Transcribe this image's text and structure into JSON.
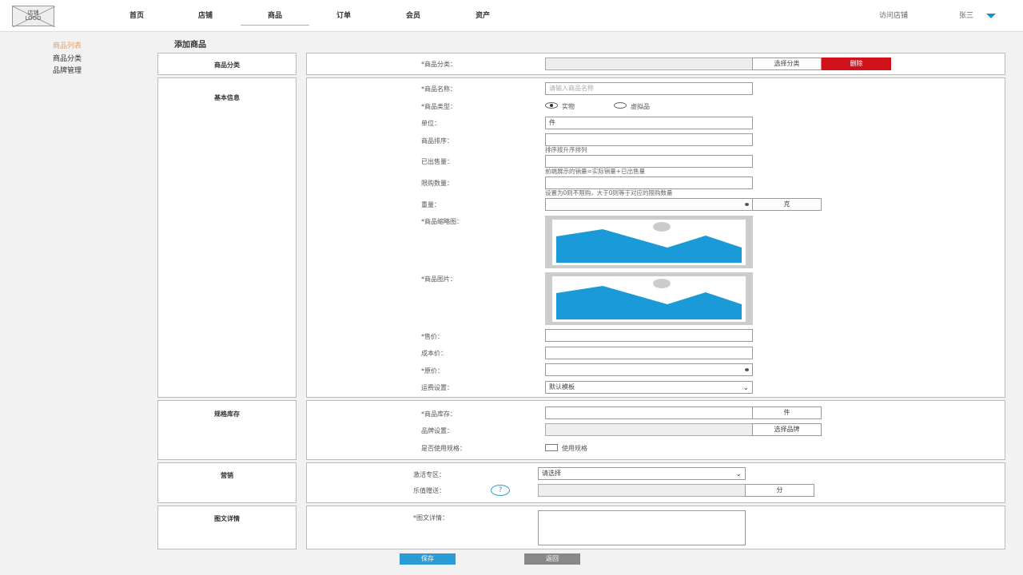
{
  "header": {
    "logo_line1": "店铺",
    "logo_line2": "LOGO",
    "nav": [
      "首页",
      "店铺",
      "商品",
      "订单",
      "会员",
      "资产"
    ],
    "visit_store": "访问店铺",
    "user": "张三"
  },
  "sidebar": {
    "items": [
      "商品列表",
      "商品分类",
      "品牌管理"
    ]
  },
  "page_title": "添加商品",
  "category_section": {
    "title": "商品分类",
    "category_label": "*商品分类：",
    "select_button": "选择分类",
    "delete_button": "删除"
  },
  "basic_section": {
    "title": "基本信息",
    "name_label": "*商品名称：",
    "name_placeholder": "请输入商品名称",
    "type_label": "*商品类型：",
    "type_options": [
      "实物",
      "虚拟品"
    ],
    "type_selected": "实物",
    "unit_label": "单位：",
    "unit_value": "件",
    "sort_label": "商品排序：",
    "sort_hint": "排序按升序排列",
    "sold_label": "已出售量：",
    "sold_hint": "前端展示的销量=实际销量+已出售量",
    "limit_label": "限购数量：",
    "limit_hint": "设置为0则不限购，大于0则等于对应的限购数量",
    "weight_label": "重量：",
    "weight_unit": "克",
    "thumb_label": "*商品缩略图：",
    "image_label": "*商品图片：",
    "price_label": "*售价：",
    "cost_label": "成本价：",
    "original_label": "*原价：",
    "shipping_label": "运费设置：",
    "shipping_value": "默认模板"
  },
  "spec_section": {
    "title": "规格库存",
    "stock_label": "*商品库存：",
    "stock_unit": "件",
    "brand_label": "品牌设置：",
    "brand_button": "选择品牌",
    "use_spec_label": "是否使用规格：",
    "use_spec_checkbox": "使用规格"
  },
  "marketing_section": {
    "title": "营销",
    "zone_label": "激活专区：",
    "zone_value": "请选择",
    "gift_label": "乐值赠送：",
    "gift_unit": "分",
    "help_glyph": "?"
  },
  "detail_section": {
    "title": "图文详情",
    "detail_label": "*图文详情："
  },
  "actions": {
    "save": "保存",
    "back": "返回"
  },
  "colors": {
    "accent_orange": "#e8a060",
    "danger_red": "#d0121b",
    "primary_blue": "#2a9bd3",
    "image_blue": "#1a9ad6"
  }
}
